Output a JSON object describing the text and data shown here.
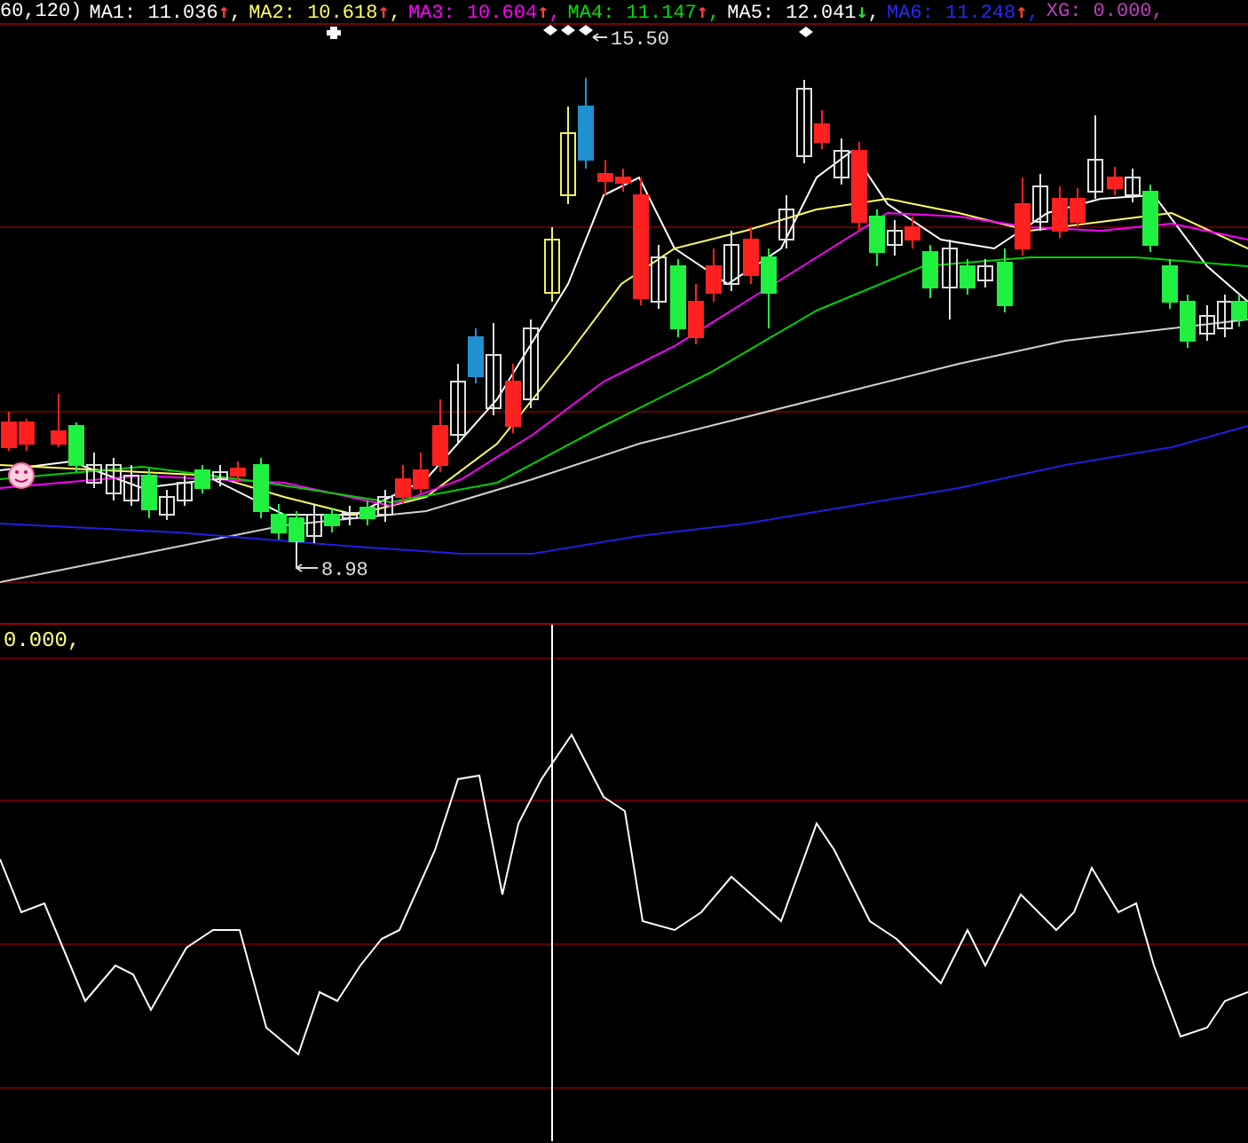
{
  "header": {
    "prefix": "60,120)",
    "items": [
      {
        "label": "MA1: 11.036",
        "arrow": {
          "text": "↑",
          "color": "#ff4040"
        },
        "sep": ",",
        "color": "#ffffff"
      },
      {
        "label": "MA2: 10.618",
        "arrow": {
          "text": "↑",
          "color": "#ff4040"
        },
        "sep": ",",
        "color": "#ffff60"
      },
      {
        "label": "MA3: 10.604",
        "arrow": {
          "text": "↑",
          "color": "#ff4040"
        },
        "sep": ",",
        "color": "#ff00ff"
      },
      {
        "label": "MA4: 11.147",
        "arrow": {
          "text": "↑",
          "color": "#ff4040"
        },
        "sep": ",",
        "color": "#00e000"
      },
      {
        "label": "MA5: 12.041",
        "arrow": {
          "text": "↓",
          "color": "#20e040"
        },
        "sep": ",",
        "color": "#ffffff"
      },
      {
        "label": "MA6: 11.248",
        "arrow": {
          "text": "↑",
          "color": "#ff4040"
        },
        "sep": ",",
        "color": "#2828ff"
      },
      {
        "label": "XG: 0.000",
        "sep": ",",
        "color": "#c040c0"
      }
    ]
  },
  "price_chart": {
    "high_label": "15.50",
    "low_label": "8.98"
  },
  "indicator_panel": {
    "label": "0.000,"
  }
}
